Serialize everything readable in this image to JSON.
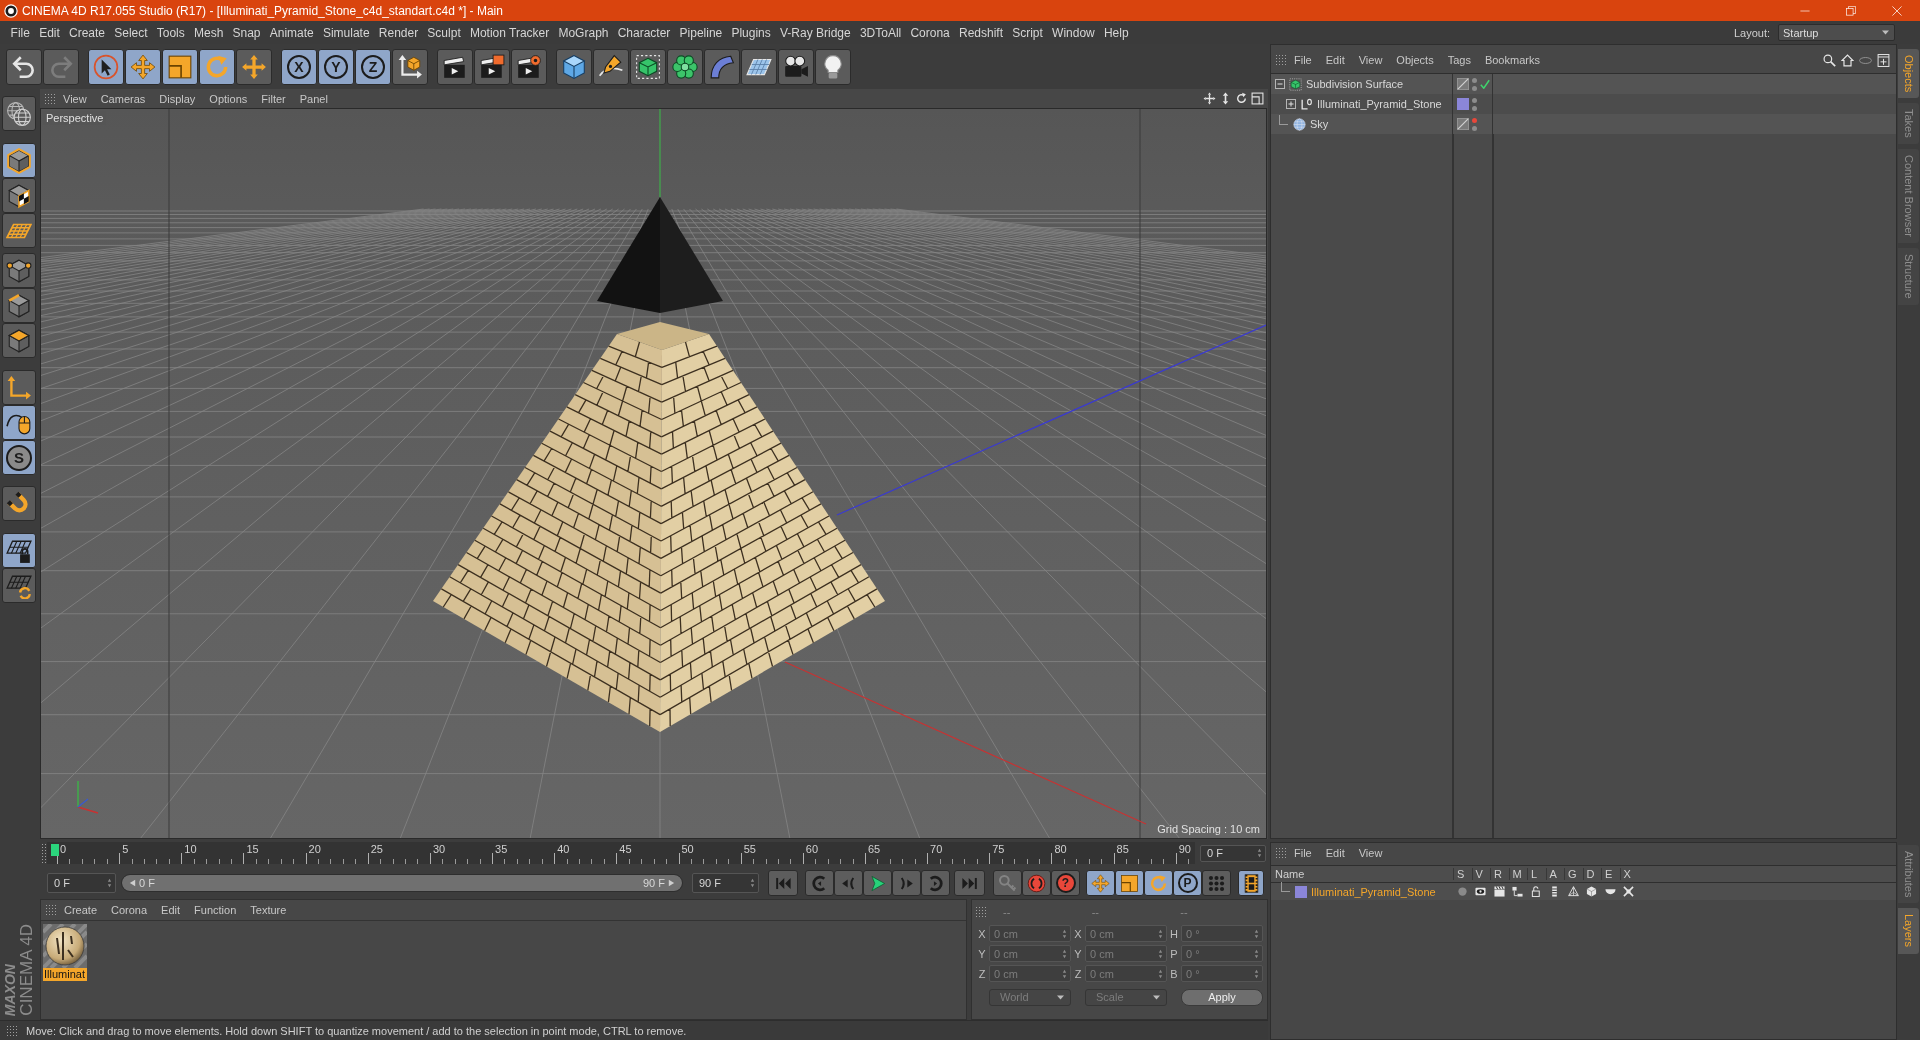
{
  "window": {
    "title": "CINEMA 4D R17.055 Studio (R17) - [Illuminati_Pyramid_Stone_c4d_standart.c4d *] - Main"
  },
  "menu_bar": {
    "items": [
      "File",
      "Edit",
      "Create",
      "Select",
      "Tools",
      "Mesh",
      "Snap",
      "Animate",
      "Simulate",
      "Render",
      "Sculpt",
      "Motion Tracker",
      "MoGraph",
      "Character",
      "Pipeline",
      "Plugins",
      "V-Ray Bridge",
      "3DToAll",
      "Corona",
      "Redshift",
      "Script",
      "Window",
      "Help"
    ],
    "layout_label": "Layout:",
    "layout": "Startup"
  },
  "toolbar": {
    "groups": [
      [
        {
          "selected": false,
          "disabled": false
        },
        {
          "selected": false,
          "disabled": true
        }
      ],
      [
        {
          "selected": true,
          "disabled": false
        },
        {
          "selected": true,
          "disabled": false
        },
        {
          "selected": true,
          "disabled": false
        },
        {
          "selected": true,
          "disabled": false
        },
        {
          "selected": false,
          "disabled": false
        }
      ],
      [
        {
          "label": "X",
          "selected": true,
          "disabled": false
        },
        {
          "label": "Y",
          "selected": true,
          "disabled": false
        },
        {
          "label": "Z",
          "selected": true,
          "disabled": false
        },
        {
          "selected": false,
          "disabled": false
        }
      ],
      [
        {
          "selected": false,
          "disabled": false
        },
        {
          "selected": false,
          "disabled": false
        },
        {
          "selected": false,
          "disabled": false
        }
      ],
      [
        {
          "selected": false,
          "disabled": false
        },
        {
          "selected": false,
          "disabled": false
        },
        {
          "selected": false,
          "disabled": false
        },
        {
          "selected": false,
          "disabled": false
        },
        {
          "selected": false,
          "disabled": false
        },
        {
          "selected": false,
          "disabled": false
        },
        {
          "selected": false,
          "disabled": false
        },
        {
          "selected": false,
          "disabled": false
        }
      ]
    ]
  },
  "left_toolbar": {
    "groups": [
      [
        {
          "selected": false
        }
      ],
      [
        {
          "selected": true
        },
        {
          "selected": false
        },
        {
          "selected": false
        }
      ],
      [
        {
          "selected": false
        },
        {
          "selected": false
        },
        {
          "selected": false
        }
      ],
      [
        {
          "selected": false
        },
        {
          "selected": true
        },
        {
          "label": "S",
          "selected": true
        }
      ],
      [
        {
          "selected": false
        }
      ],
      [
        {
          "selected": true
        },
        {
          "selected": false
        }
      ]
    ]
  },
  "viewport": {
    "menu": [
      "View",
      "Cameras",
      "Display",
      "Options",
      "Filter",
      "Panel"
    ],
    "camera": "Perspective",
    "grid_spacing": "Grid Spacing : 10 cm"
  },
  "timeline": {
    "ticks": [
      "0",
      "5",
      "10",
      "15",
      "20",
      "25",
      "30",
      "35",
      "40",
      "45",
      "50",
      "55",
      "60",
      "65",
      "70",
      "75",
      "80",
      "85",
      "90"
    ],
    "level": 0,
    "frame_field": "0 F"
  },
  "playback": {
    "start": "0 F",
    "range": {
      "level": 1,
      "start": "0 F",
      "end": "90 F"
    },
    "end": "90 F",
    "record": [
      {
        "disabled": true
      },
      {
        "disabled": false
      },
      {
        "label": "?",
        "disabled": false
      }
    ],
    "key_tools": [
      {
        "selected": true
      },
      {
        "selected": true
      },
      {
        "selected": true
      },
      {
        "label": "P",
        "selected": true
      },
      {
        "selected": false
      }
    ],
    "timeline_toggle": {
      "selected": true
    }
  },
  "material_manager": {
    "menu": [
      "Create",
      "Corona",
      "Edit",
      "Function",
      "Texture"
    ],
    "materials": [
      {
        "name": "Illuminat",
        "selected": true
      }
    ]
  },
  "coordinates": {
    "headers": [
      "--",
      "--",
      "--"
    ],
    "rows": [
      {
        "axis": "X",
        "position": "0 cm",
        "size_axis": "X",
        "size": "0 cm",
        "angle_axis": "H",
        "angle": "0 °"
      },
      {
        "axis": "Y",
        "position": "0 cm",
        "size_axis": "Y",
        "size": "0 cm",
        "angle_axis": "P",
        "angle": "0 °"
      },
      {
        "axis": "Z",
        "position": "0 cm",
        "size_axis": "Z",
        "size": "0 cm",
        "angle_axis": "B",
        "angle": "0 °"
      }
    ],
    "space": "World",
    "size_mode": "Scale",
    "apply": "Apply"
  },
  "object_manager": {
    "menu": [
      "File",
      "Edit",
      "View",
      "Objects",
      "Tags",
      "Bookmarks"
    ],
    "objects": [
      {
        "name": "Subdivision Surface",
        "kind": "generator",
        "expanded": true,
        "selected": false,
        "editor_hidden": false,
        "enabled": true,
        "children": [
          {
            "name": "Illuminati_Pyramid_Stone",
            "kind": "polygon",
            "expanded": false,
            "selected": false,
            "editor_hidden": false,
            "color": "#8b86d9"
          }
        ]
      },
      {
        "name": "Sky",
        "kind": "sky",
        "selected": false,
        "editor_hidden": true
      }
    ]
  },
  "layer_manager": {
    "menu": [
      "File",
      "Edit",
      "View"
    ],
    "columns": [
      "Name",
      "S",
      "V",
      "R",
      "M",
      "L",
      "A",
      "G",
      "D",
      "E",
      "X"
    ],
    "layers": [
      {
        "name": "Illuminati_Pyramid_Stone",
        "color": "#8b86d9",
        "selected": true
      }
    ]
  },
  "side_tabs": {
    "top": [
      {
        "label": "Objects",
        "selected": true
      },
      {
        "label": "Takes",
        "selected": false
      },
      {
        "label": "Content Browser",
        "selected": false
      },
      {
        "label": "Structure",
        "selected": false
      }
    ],
    "bottom": [
      {
        "label": "Attributes",
        "selected": false
      },
      {
        "label": "Layers",
        "selected": true
      }
    ]
  },
  "logo": {
    "brand": "MAXON",
    "product": "CINEMA 4D"
  },
  "status_bar": {
    "text": "Move: Click and drag to move elements. Hold down SHIFT to quantize movement / add to the selection in point mode, CTRL to remove."
  }
}
